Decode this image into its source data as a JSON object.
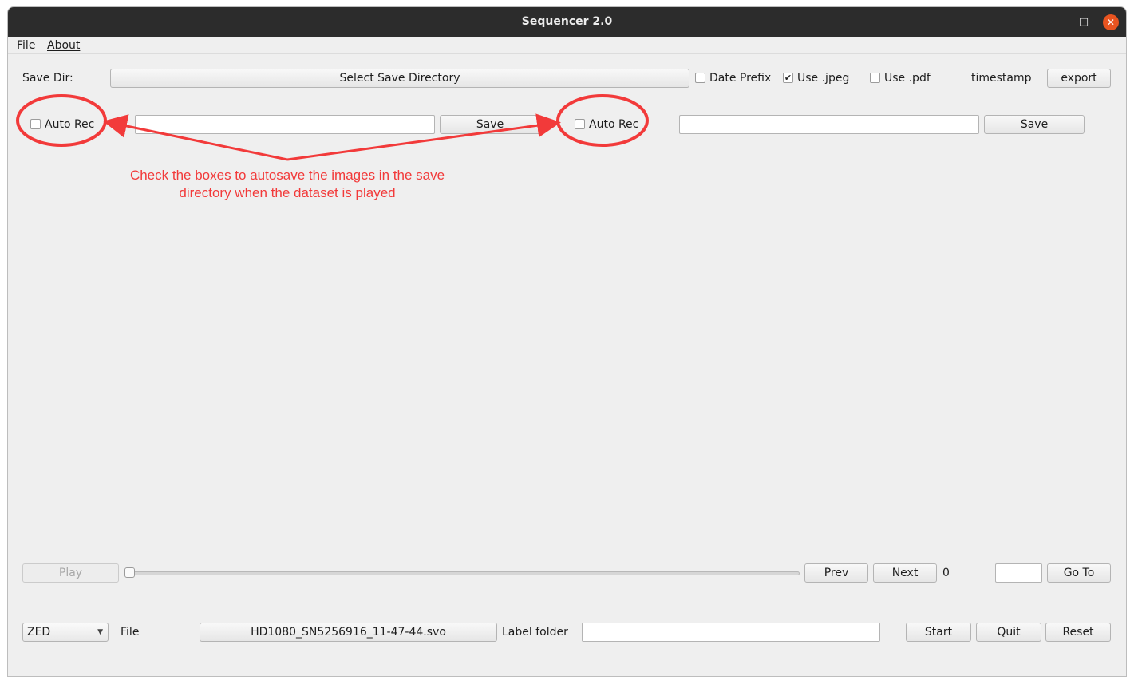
{
  "window": {
    "title": "Sequencer 2.0"
  },
  "menu": {
    "file": "File",
    "about": "About"
  },
  "save_row": {
    "save_dir_label": "Save Dir:",
    "select_button": "Select Save Directory",
    "date_prefix": {
      "label": "Date Prefix",
      "checked": false
    },
    "use_jpeg": {
      "label": "Use .jpeg",
      "checked": true
    },
    "use_pdf": {
      "label": "Use .pdf",
      "checked": false
    },
    "timestamp_label": "timestamp",
    "export_button": "export"
  },
  "stream_left": {
    "auto_rec_label": "Auto Rec",
    "auto_rec_checked": false,
    "path_value": "",
    "save_button": "Save"
  },
  "stream_right": {
    "auto_rec_label": "Auto Rec",
    "auto_rec_checked": false,
    "path_value": "",
    "save_button": "Save"
  },
  "annotation": {
    "line1": "Check the boxes to autosave the images in the save",
    "line2": "directory when the dataset is played",
    "color": "#f23a3a"
  },
  "playback": {
    "play_button": "Play",
    "slider_value": 0,
    "prev_button": "Prev",
    "next_button": "Next",
    "frame_counter": "0",
    "goto_value": "",
    "goto_button": "Go To"
  },
  "bottom": {
    "camera_select": "ZED",
    "file_label": "File",
    "file_button": "HD1080_SN5256916_11-47-44.svo",
    "label_folder_label": "Label folder",
    "label_folder_value": "",
    "start_button": "Start",
    "quit_button": "Quit",
    "reset_button": "Reset"
  },
  "titlebar_icons": {
    "minimize": "minimize-icon",
    "maximize": "maximize-icon",
    "close": "close-icon"
  }
}
